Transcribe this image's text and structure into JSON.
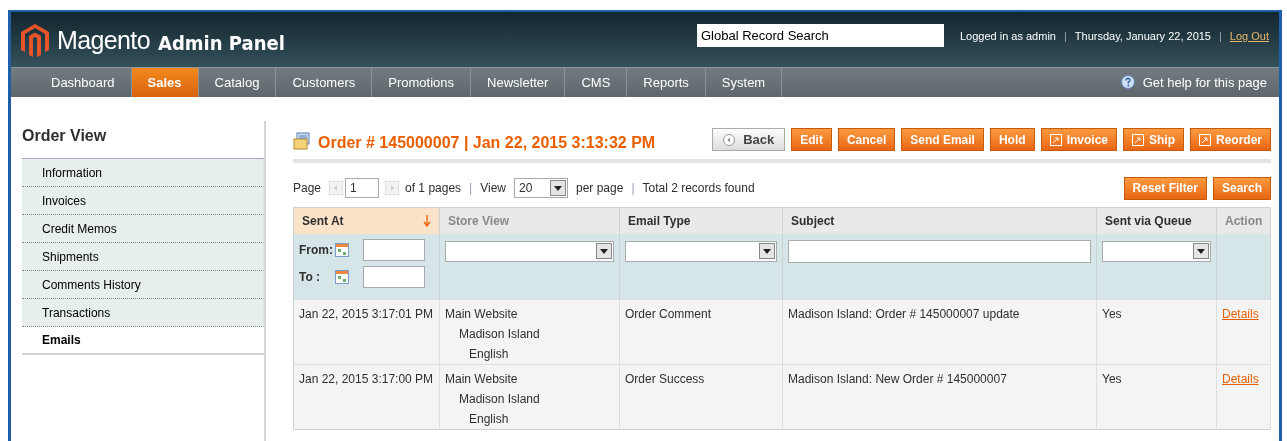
{
  "header": {
    "logo": "Magento",
    "logo_suffix": "Admin Panel",
    "search": {
      "value": "Global Record Search"
    },
    "user": "Logged in as admin",
    "separators": [
      "|",
      "|"
    ],
    "date": "Thursday, January 22, 2015",
    "logout": "Log Out"
  },
  "nav": {
    "items": [
      {
        "label": "Dashboard",
        "selected": false
      },
      {
        "label": "Sales",
        "selected": true
      },
      {
        "label": "Catalog",
        "selected": false
      },
      {
        "label": "Customers",
        "selected": false
      },
      {
        "label": "Promotions",
        "selected": false
      },
      {
        "label": "Newsletter",
        "selected": false
      },
      {
        "label": "CMS",
        "selected": false
      },
      {
        "label": "Reports",
        "selected": false
      },
      {
        "label": "System",
        "selected": false
      }
    ],
    "help": "Get help for this page"
  },
  "sidebar": {
    "title": "Order View",
    "items": [
      {
        "label": "Information",
        "selected": false
      },
      {
        "label": "Invoices",
        "selected": false
      },
      {
        "label": "Credit Memos",
        "selected": false
      },
      {
        "label": "Shipments",
        "selected": false
      },
      {
        "label": "Comments History",
        "selected": false
      },
      {
        "label": "Transactions",
        "selected": false
      },
      {
        "label": "Emails",
        "selected": true
      }
    ]
  },
  "title": "Order # 145000007 | Jan 22, 2015 3:13:32 PM",
  "buttons": [
    {
      "label": "Back",
      "kind": "back"
    },
    {
      "label": "Edit",
      "kind": "plain"
    },
    {
      "label": "Cancel",
      "kind": "plain"
    },
    {
      "label": "Send Email",
      "kind": "plain"
    },
    {
      "label": "Hold",
      "kind": "plain"
    },
    {
      "label": "Invoice",
      "kind": "icon"
    },
    {
      "label": "Ship",
      "kind": "icon"
    },
    {
      "label": "Reorder",
      "kind": "icon"
    }
  ],
  "pager": {
    "page_label": "Page",
    "page": "1",
    "of_pages": "of 1 pages",
    "view_label": "View",
    "per_page": "20",
    "per_page_label": "per page",
    "separators": [
      "|",
      "|"
    ],
    "total": "Total 2 records found"
  },
  "grid_buttons": [
    "Reset Filter",
    "Search"
  ],
  "table": {
    "columns": [
      {
        "label": "Sent At",
        "sorted": true,
        "sortable": true,
        "filter": {
          "kind": "date"
        }
      },
      {
        "label": "Store View",
        "sorted": false,
        "sortable": false,
        "filter": {
          "kind": "select"
        }
      },
      {
        "label": "Email Type",
        "sorted": false,
        "sortable": true,
        "filter": {
          "kind": "select"
        }
      },
      {
        "label": "Subject",
        "sorted": false,
        "sortable": true,
        "filter": {
          "kind": "text"
        }
      },
      {
        "label": "Sent via Queue",
        "sorted": false,
        "sortable": true,
        "filter": {
          "kind": "select"
        }
      },
      {
        "label": "Action",
        "sorted": false,
        "sortable": false,
        "filter": {
          "kind": "none"
        }
      }
    ],
    "date_filter": {
      "from": "From:",
      "to": "To :"
    },
    "rows": [
      {
        "sent_at": "Jan 22, 2015 3:17:01 PM",
        "store_view": {
          "website": "Main Website",
          "store": "Madison Island",
          "view": "English"
        },
        "email_type": "Order Comment",
        "subject": "Madison Island: Order # 145000007 update",
        "queue": "Yes",
        "action": "Details"
      },
      {
        "sent_at": "Jan 22, 2015 3:17:00 PM",
        "store_view": {
          "website": "Main Website",
          "store": "Madison Island",
          "view": "English"
        },
        "email_type": "Order Success",
        "subject": "Madison Island: New Order # 145000007",
        "queue": "Yes",
        "action": "Details"
      }
    ]
  }
}
